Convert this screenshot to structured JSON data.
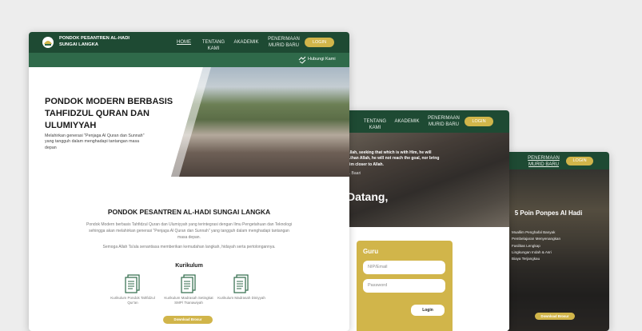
{
  "colors": {
    "nav_green": "#1e4a33",
    "subnav_green": "#2f6a4a",
    "gold": "#d1b54a"
  },
  "card_main": {
    "brand": "PONDOK PESANTREN AL-HADI SUNGAI LANGKA",
    "nav": [
      "HOME",
      "TENTANG KAMI",
      "AKADEMIK",
      "PENERIMAAN MURID BARU"
    ],
    "login_label": "LOGIN",
    "contact_label": "Hubungi Kami",
    "contact_icon": "handshake-icon",
    "hero_title": "PONDOK MODERN BERBASIS TAHFIDZUL QURAN DAN ULUMIYYAH",
    "hero_subtitle": "Melahirkan generasi \"Penjaga Al Quran dan Sunnah\" yang tangguh dalam menghadapi tantangan masa depan",
    "section_title": "PONDOK PESANTREN AL-HADI SUNGAI LANGKA",
    "paragraph_1": "Pondok Modern berbasis Tahfidzul Quran dan Ulumiyyah yang terintegrasi dengan Ilmu Pengetahuan dan Teknologi sehingga akan melahirkan generasi \"Penjaga Al Quran dan Sunnah\" yang tangguh dalam menghadapi tantangan masa depan.",
    "paragraph_2": "Semoga Allah Ta'ala senantiasa memberikan kemudahan langkah, hidayah serta pertolongannya.",
    "kurikulum_title": "Kurikulum",
    "kurikulum": [
      {
        "label": "Kurikulum Pondok Tahfidzul Qur'an",
        "icon": "document-icon"
      },
      {
        "label": "Kurikulum Madrasah Setingkat SMP/ Tsanawiyah",
        "icon": "document-icon"
      },
      {
        "label": "Kurikulum Madrasah Diniyyah",
        "icon": "document-icon"
      }
    ],
    "download_label": "Download Brosur"
  },
  "card_login": {
    "nav": [
      "TENTANG KAMI",
      "AKADEMIK",
      "PENERIMAAN MURID BARU"
    ],
    "login_label": "LOGIN",
    "quote": "Allah, seeking that which is with Him, he will ...than Allah, he will not reach the goal, nor bring him closer to Allah.",
    "quote_author": "... Baari",
    "welcome": "Datang,",
    "form_title": "Guru",
    "nip_placeholder": "NIP/Email",
    "password_placeholder": "Password",
    "submit_label": "Login"
  },
  "card_poin": {
    "nav": [
      "PENERIMAAN MURID BARU"
    ],
    "login_label": "LOGIN",
    "title": "5 Poin Ponpes Al Hadi",
    "points": [
      "Muallim Penghafal Banyak",
      "Pembelajaran Menyenangkan",
      "Fasilitas Lengkap",
      "Lingkungan Indah & Asri",
      "Biaya Terjangkau"
    ],
    "download_label": "Download Brosur"
  }
}
